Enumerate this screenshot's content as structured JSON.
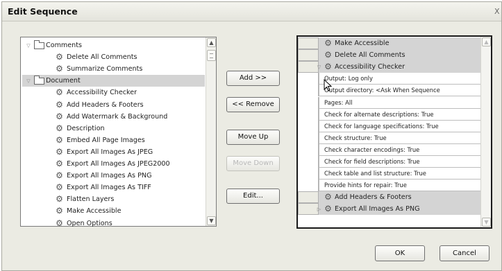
{
  "dialog": {
    "title": "Edit Sequence",
    "close_glyph": "X"
  },
  "available_commands": {
    "items": [
      {
        "kind": "folder",
        "label": "Comments",
        "expanded": true
      },
      {
        "kind": "command",
        "label": "Delete All Comments"
      },
      {
        "kind": "command",
        "label": "Summarize Comments"
      },
      {
        "kind": "folder",
        "label": "Document",
        "expanded": true,
        "selected": true
      },
      {
        "kind": "command",
        "label": "Accessibility Checker"
      },
      {
        "kind": "command",
        "label": "Add Headers & Footers"
      },
      {
        "kind": "command",
        "label": "Add Watermark & Background"
      },
      {
        "kind": "command",
        "label": "Description"
      },
      {
        "kind": "command",
        "label": "Embed All Page Images"
      },
      {
        "kind": "command",
        "label": "Export All Images As JPEG"
      },
      {
        "kind": "command",
        "label": "Export All Images As JPEG2000"
      },
      {
        "kind": "command",
        "label": "Export All Images As PNG"
      },
      {
        "kind": "command",
        "label": "Export All Images As TIFF"
      },
      {
        "kind": "command",
        "label": "Flatten Layers"
      },
      {
        "kind": "command",
        "label": "Make Accessible"
      },
      {
        "kind": "command",
        "label": "Open Options"
      }
    ]
  },
  "buttons": {
    "add": "Add >>",
    "remove": "<< Remove",
    "move_up": "Move Up",
    "move_down": "Move Down",
    "edit": "Edit...",
    "ok": "OK",
    "cancel": "Cancel"
  },
  "sequence": {
    "steps": [
      {
        "label": "Make Accessible"
      },
      {
        "label": "Delete All Comments"
      },
      {
        "label": "Accessibility Checker",
        "expanded": true
      }
    ],
    "parameters": [
      "Output: Log only",
      "Output directory: <Ask When Sequence",
      "Pages: All",
      "Check for alternate descriptions: True",
      "Check for language specifications: True",
      "Check structure: True",
      "Check character encodings: True",
      "Check for field descriptions: True",
      "Check table and list structure: True",
      "Provide hints for repair: True"
    ],
    "more_steps": [
      {
        "label": "Add Headers & Footers"
      },
      {
        "label": "Export All Images As PNG",
        "collapsed": true
      }
    ]
  },
  "icons": {
    "gear": "gear-icon",
    "folder": "folder-icon",
    "expand": "chevron-down-icon",
    "collapse": "chevron-right-icon"
  }
}
